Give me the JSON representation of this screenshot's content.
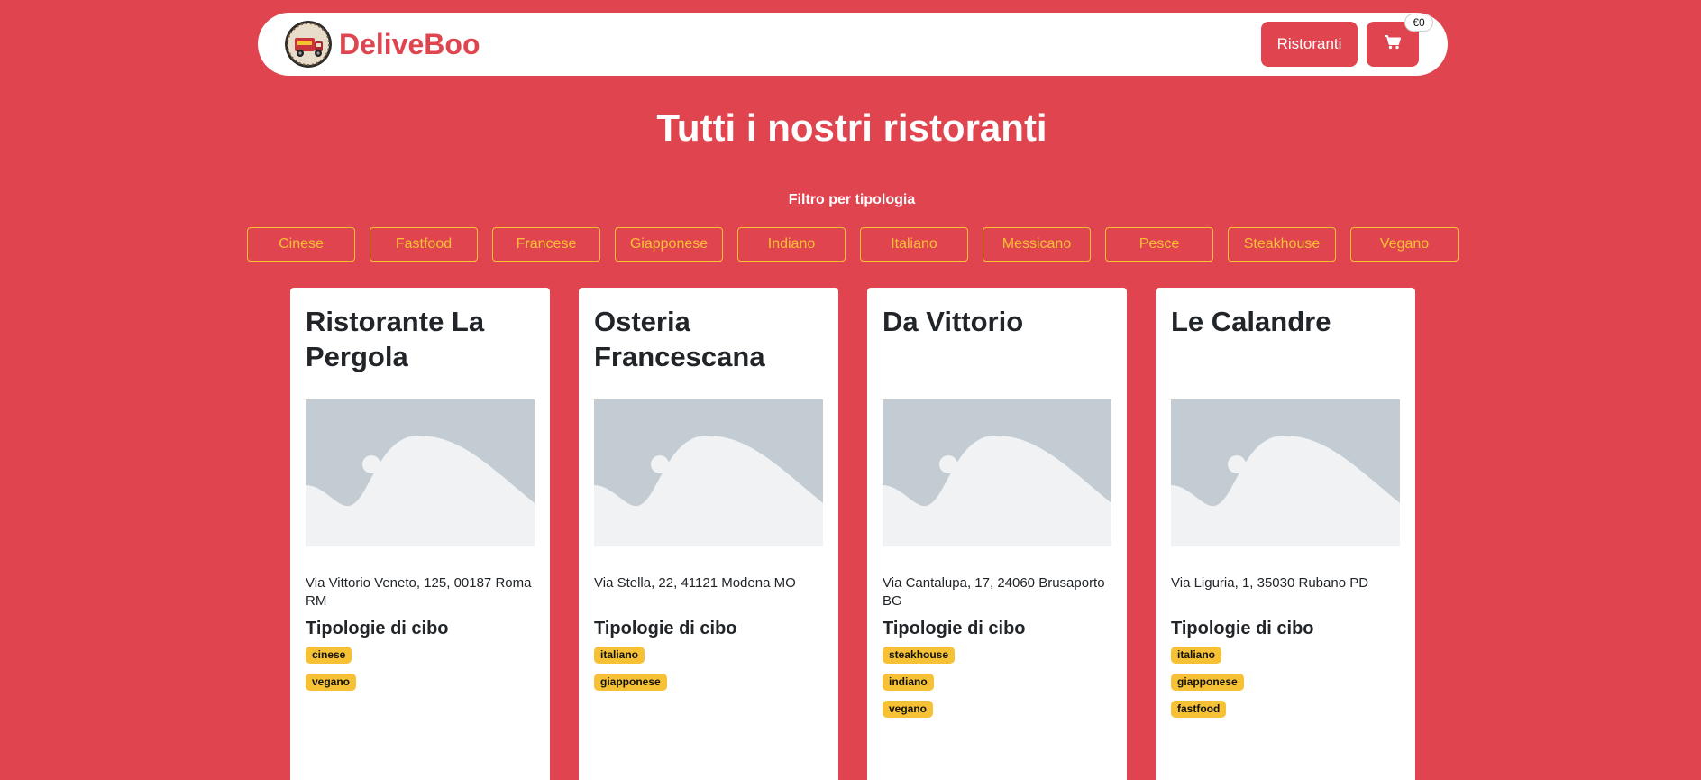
{
  "navbar": {
    "brand": "DeliveBoo",
    "restaurants_label": "Ristoranti",
    "cart_total": "€0"
  },
  "page": {
    "title": "Tutti i nostri ristoranti",
    "filter_label": "Filtro per tipologia"
  },
  "filters": [
    "Cinese",
    "Fastfood",
    "Francese",
    "Giapponese",
    "Indiano",
    "Italiano",
    "Messicano",
    "Pesce",
    "Steakhouse",
    "Vegano"
  ],
  "cards_section": {
    "types_heading": "Tipologie di cibo"
  },
  "restaurants": [
    {
      "name": "Ristorante La Pergola",
      "address": "Via Vittorio Veneto, 125, 00187 Roma RM",
      "types": [
        "cinese",
        "vegano"
      ]
    },
    {
      "name": "Osteria Francescana",
      "address": "Via Stella, 22, 41121 Modena MO",
      "types": [
        "italiano",
        "giapponese"
      ]
    },
    {
      "name": "Da Vittorio",
      "address": "Via Cantalupa, 17, 24060 Brusaporto BG",
      "types": [
        "steakhouse",
        "indiano",
        "vegano"
      ]
    },
    {
      "name": "Le Calandre",
      "address": "Via Liguria, 1, 35030 Rubano PD",
      "types": [
        "italiano",
        "giapponese",
        "fastfood"
      ]
    }
  ],
  "colors": {
    "background": "#e0444e",
    "accent_yellow": "#f6c134",
    "card_bg": "#ffffff",
    "placeholder_dark": "#c3cbd3",
    "placeholder_light": "#f0f2f4"
  },
  "icons": {
    "logo": "delivery-truck-logo-icon",
    "cart": "shopping-cart-icon",
    "image_placeholder": "image-placeholder-icon"
  }
}
